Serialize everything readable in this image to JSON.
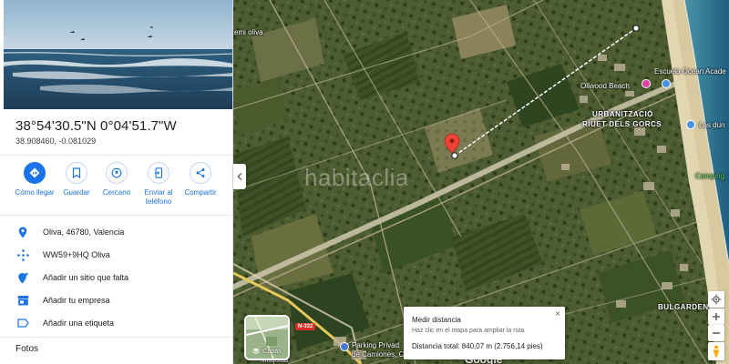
{
  "place": {
    "coords_dms": "38°54'30.5\"N 0°04'51.7\"W",
    "coords_decimal": "38.908460, -0.081029"
  },
  "actions": [
    {
      "label": "Cómo llegar",
      "icon": "directions-icon"
    },
    {
      "label": "Guardar",
      "icon": "bookmark-icon"
    },
    {
      "label": "Cercano",
      "icon": "nearby-icon"
    },
    {
      "label": "Enviar al teléfono",
      "icon": "send-to-phone-icon"
    },
    {
      "label": "Compartir",
      "icon": "share-icon"
    }
  ],
  "info": {
    "address": "Oliva, 46780, Valencia",
    "plus_code": "WW59+9HQ Oliva",
    "add_place": "Añadir un sitio que falta",
    "add_business": "Añadir tu empresa",
    "add_label": "Añadir una etiqueta"
  },
  "photos_title": "Fotos",
  "map": {
    "labels": {
      "emi_oliva": "emi oliva",
      "escuela": "Escuela Ocean Acade",
      "oliwood": "Oliwood Beach",
      "urbanitzacio_1": "URBANITZACIÓ",
      "urbanitzacio_2": "RIUET DELS GORCS",
      "las_dunas": "Las dun",
      "camping": "Camping",
      "bulgarden": "BULGARDEN",
      "parking_1": "Parking Privad",
      "parking_2": "de Camiones, C",
      "maquisa": "Maquisa",
      "road_n332": "N-332"
    },
    "watermark": "habitaclia",
    "layers_label": "Capas",
    "google": "Google",
    "colors": {
      "accent": "#1a73e8",
      "pin": "#ea4335",
      "sea": "#3a7fa0"
    }
  },
  "measure": {
    "title": "Medir distancia",
    "hint": "Haz clic en el mapa para ampliar la ruta",
    "total": "Distancia total: 840,07 m (2.756,14 pies)",
    "close": "×"
  }
}
